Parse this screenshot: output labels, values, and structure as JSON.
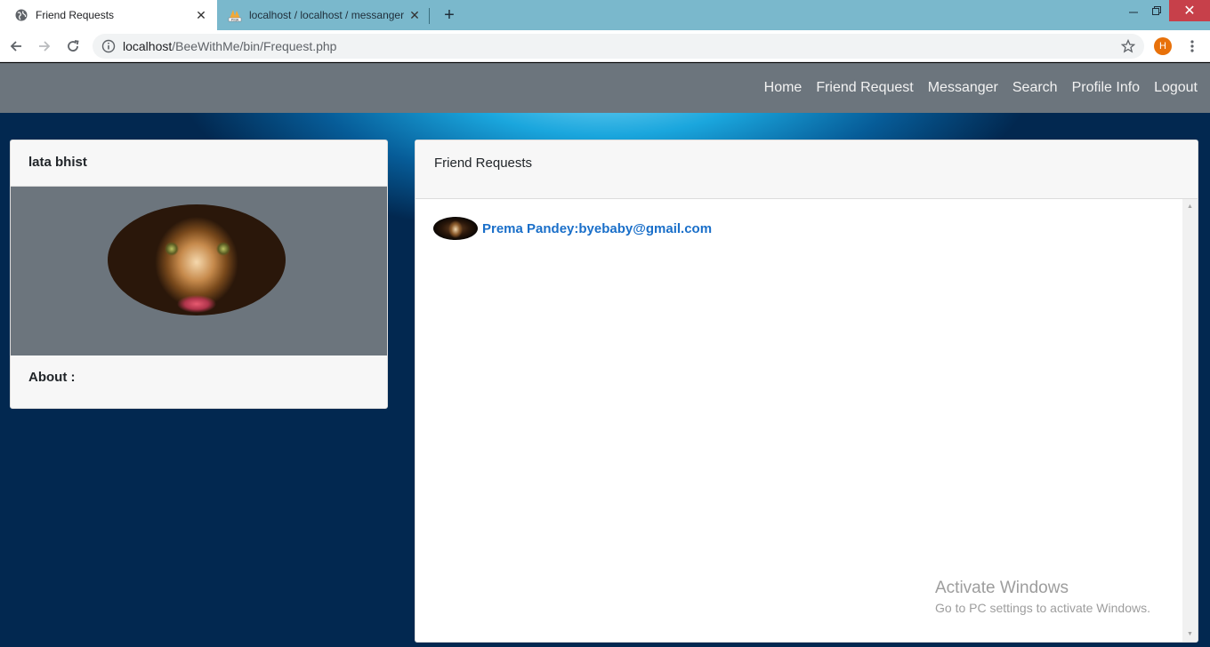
{
  "browser": {
    "tabs": [
      {
        "title": "Friend Requests",
        "favicon": "globe-icon",
        "active": true
      },
      {
        "title": "localhost / localhost / messanger",
        "favicon": "phpmyadmin-icon",
        "active": false
      }
    ],
    "url_host": "localhost",
    "url_path": "/BeeWithMe/bin/Frequest.php",
    "profile_initial": "H",
    "profile_color": "#e8710a"
  },
  "navbar": {
    "links": [
      "Home",
      "Friend Request",
      "Messanger",
      "Search",
      "Profile Info",
      "Logout"
    ],
    "background": "#6c757d"
  },
  "profile": {
    "name": "lata bhist",
    "about_label": "About :"
  },
  "requests": {
    "title": "Friend Requests",
    "items": [
      {
        "label": "Prema Pandey:byebaby@gmail.com"
      }
    ],
    "link_color": "#1a6fc9"
  },
  "watermark": {
    "title": "Activate Windows",
    "subtitle": "Go to PC settings to activate Windows."
  }
}
